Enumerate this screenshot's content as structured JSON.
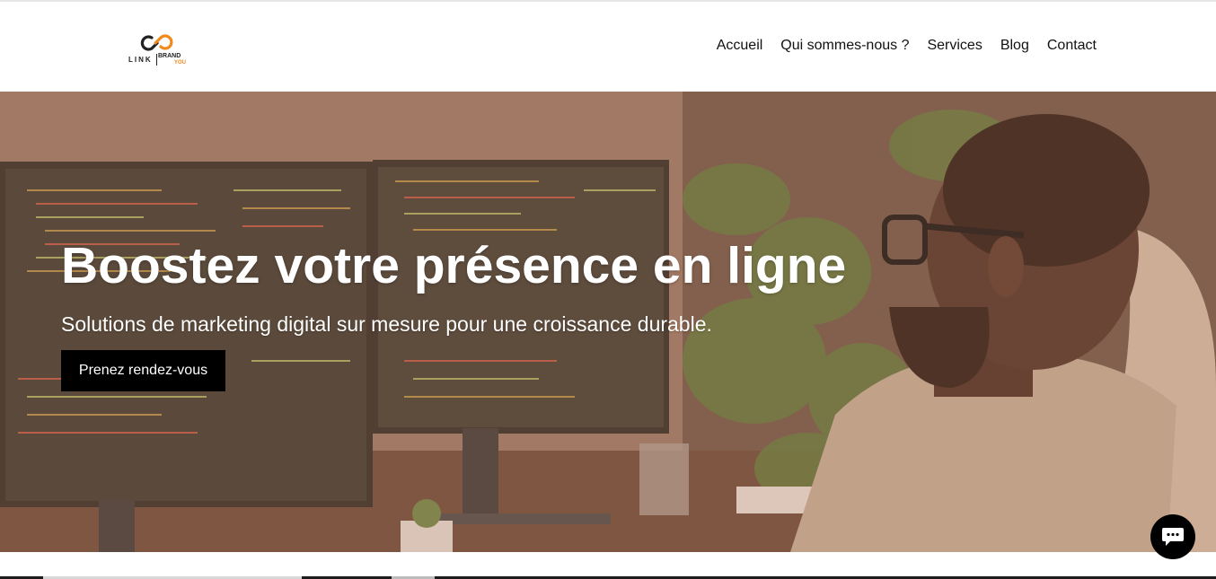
{
  "header": {
    "logo": {
      "link_text": "LINK",
      "brand_text": "BRAND",
      "you_text": "YOU",
      "colors": {
        "dark": "#222222",
        "accent": "#f08a1c"
      }
    },
    "nav": [
      {
        "label": "Accueil"
      },
      {
        "label": "Qui sommes-nous ?"
      },
      {
        "label": "Services"
      },
      {
        "label": "Blog"
      },
      {
        "label": "Contact"
      }
    ]
  },
  "hero": {
    "title": "Boostez votre présence en ligne",
    "subtitle": "Solutions de marketing digital sur mesure pour une croissance durable.",
    "cta_label": "Prenez rendez-vous",
    "image_icon": "developer-at-monitors-photo"
  },
  "chat": {
    "icon": "chat-bubble-icon"
  },
  "colors": {
    "cta_bg": "#000000",
    "text_light": "#ffffff",
    "overlay": "#b4785a"
  }
}
